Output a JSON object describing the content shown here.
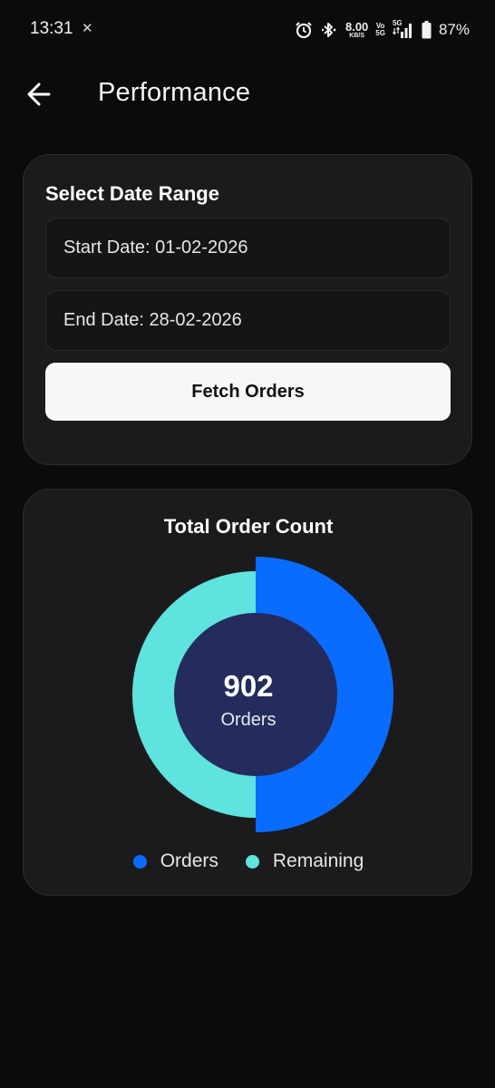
{
  "status_bar": {
    "time": "13:31",
    "network_speed_value": "8.00",
    "network_speed_unit": "KB/S",
    "volte_top": "Vo",
    "volte_bottom": "5G",
    "signal_label": "5G",
    "battery_percent": "87%",
    "icons": [
      "x-app-icon",
      "alarm-icon",
      "bluetooth-icon",
      "signal-icon",
      "battery-icon"
    ]
  },
  "header": {
    "title": "Performance",
    "back_icon": "arrow-left-icon"
  },
  "date_range": {
    "title": "Select Date Range",
    "start_label": "Start Date: 01-02-2026",
    "end_label": "End Date: 28-02-2026",
    "fetch_button": "Fetch Orders"
  },
  "order_count": {
    "title": "Total Order Count",
    "center_value": "902",
    "center_label": "Orders"
  },
  "chart_data": {
    "type": "pie",
    "title": "Total Order Count",
    "categories": [
      "Orders",
      "Remaining"
    ],
    "values": [
      50,
      50
    ],
    "colors": [
      "#0a6cff",
      "#5ee3de"
    ],
    "center_color": "#232c5c",
    "legend_position": "bottom",
    "series": [
      {
        "name": "Orders",
        "value": 50,
        "color": "#0a6cff"
      },
      {
        "name": "Remaining",
        "value": 50,
        "color": "#5ee3de"
      }
    ]
  }
}
